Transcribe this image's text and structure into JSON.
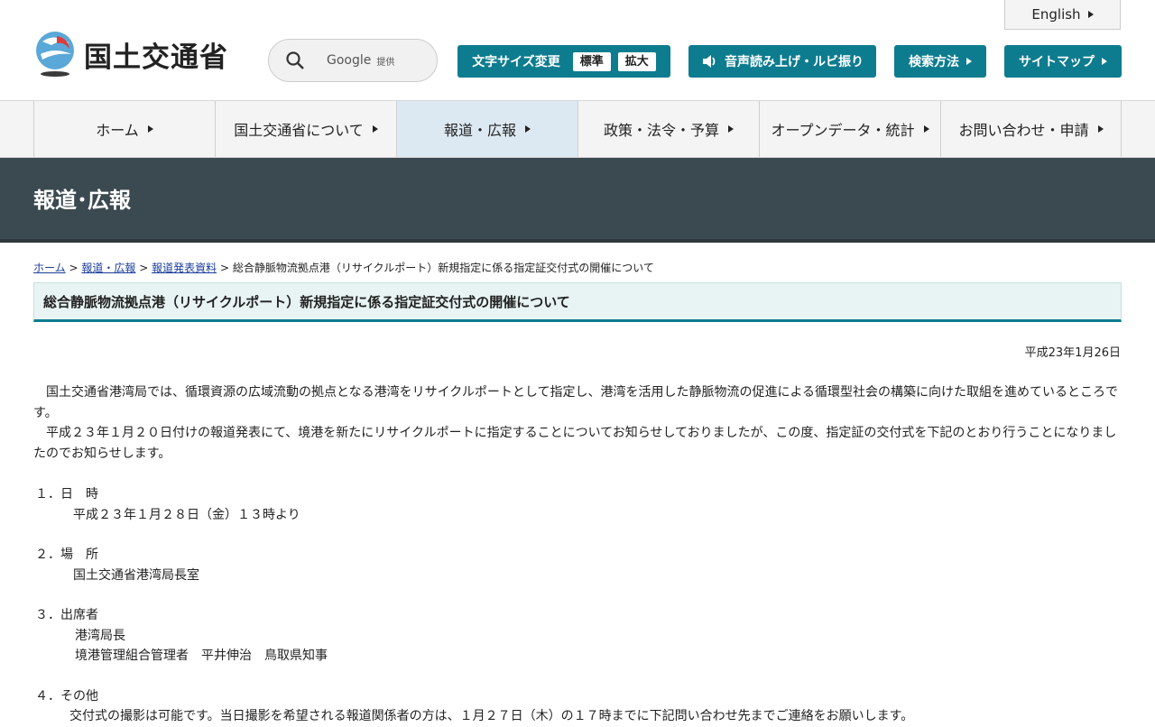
{
  "header": {
    "logo_text": "国土交通省",
    "search_google": "Google",
    "search_provided": "提供",
    "english": "English",
    "font_size_label": "文字サイズ変更",
    "font_standard": "標準",
    "font_large": "拡大",
    "voice_label": "音声読み上げ・ルビ振り",
    "search_method": "検索方法",
    "sitemap": "サイトマップ"
  },
  "gnav": [
    {
      "label": "ホーム"
    },
    {
      "label": "国土交通省について"
    },
    {
      "label": "報道・広報"
    },
    {
      "label": "政策・法令・予算"
    },
    {
      "label": "オープンデータ・統計"
    },
    {
      "label": "お問い合わせ・申請"
    }
  ],
  "hero_title": "報道･広報",
  "breadcrumb": {
    "home": "ホーム",
    "sep": ">",
    "press": "報道・広報",
    "releases": "報道発表資料",
    "current": "総合静脈物流拠点港（リサイクルポート）新規指定に係る指定証交付式の開催について"
  },
  "page_title": "総合静脈物流拠点港（リサイクルポート）新規指定に係る指定証交付式の開催について",
  "date": "平成23年1月26日",
  "body": {
    "para1": "　国土交通省港湾局では、循環資源の広域流動の拠点となる港湾をリサイクルポートとして指定し、港湾を活用した静脈物流の促進による循環型社会の構築に向けた取組を進めているところです。",
    "para2": "　平成２３年１月２０日付けの報道発表にて、境港を新たにリサイクルポートに指定することについてお知らせしておりましたが、この度、指定証の交付式を下記のとおり行うことになりましたのでお知らせします。",
    "s1_title": "１．日　時",
    "s1_text": "平成２３年１月２８日（金）１３時より",
    "s2_title": "２．場　所",
    "s2_text": "国土交通省港湾局長室",
    "s3_title": "３．出席者",
    "s3_line1": "港湾局長",
    "s3_line2": "境港管理組合管理者　平井伸治　鳥取県知事",
    "s4_title": "４．その他",
    "s4_text": "交付式の撮影は可能です。当日撮影を希望される報道関係者の方は、１月２７日（木）の１７時までに下記問い合わせ先までご連絡をお願いします。"
  },
  "colors": {
    "accent": "#0d7c8f",
    "hero_bg": "#3b4950",
    "nav_active": "#dde9f2"
  }
}
